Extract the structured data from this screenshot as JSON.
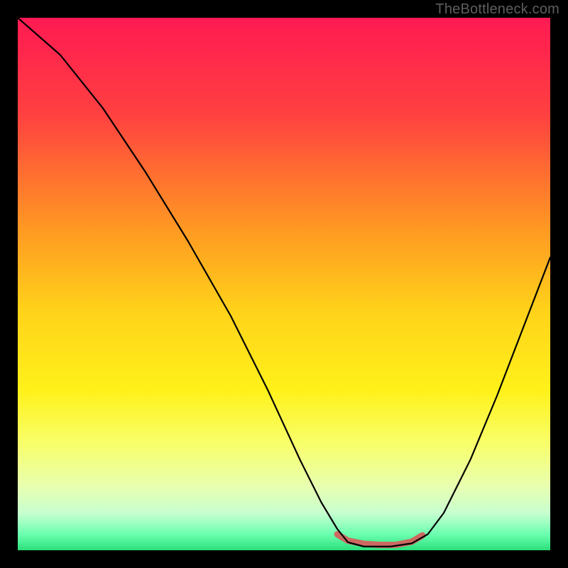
{
  "watermark": "TheBottleneck.com",
  "chart_data": {
    "type": "line",
    "title": "",
    "xlabel": "",
    "ylabel": "",
    "xlim": [
      0,
      100
    ],
    "ylim": [
      0,
      100
    ],
    "gradient_stops": [
      {
        "offset": 0,
        "color": "#ff1a53"
      },
      {
        "offset": 18,
        "color": "#ff4040"
      },
      {
        "offset": 40,
        "color": "#ff9a22"
      },
      {
        "offset": 55,
        "color": "#ffd21a"
      },
      {
        "offset": 70,
        "color": "#fff11a"
      },
      {
        "offset": 80,
        "color": "#f8ff6a"
      },
      {
        "offset": 88,
        "color": "#e8ffb0"
      },
      {
        "offset": 93,
        "color": "#c8ffd0"
      },
      {
        "offset": 97,
        "color": "#6bffb0"
      },
      {
        "offset": 100,
        "color": "#2bdf7a"
      }
    ],
    "series": [
      {
        "name": "bottleneck-curve",
        "stroke": "#000000",
        "stroke_width": 2.2,
        "points": [
          {
            "x": 0,
            "y": 100
          },
          {
            "x": 8,
            "y": 93
          },
          {
            "x": 16,
            "y": 83
          },
          {
            "x": 24,
            "y": 71
          },
          {
            "x": 32,
            "y": 58
          },
          {
            "x": 40,
            "y": 44
          },
          {
            "x": 47,
            "y": 30
          },
          {
            "x": 53,
            "y": 17
          },
          {
            "x": 57,
            "y": 9
          },
          {
            "x": 60,
            "y": 4
          },
          {
            "x": 62,
            "y": 1.5
          },
          {
            "x": 65,
            "y": 0.7
          },
          {
            "x": 70,
            "y": 0.7
          },
          {
            "x": 74,
            "y": 1.3
          },
          {
            "x": 77,
            "y": 3
          },
          {
            "x": 80,
            "y": 7
          },
          {
            "x": 85,
            "y": 17
          },
          {
            "x": 90,
            "y": 29
          },
          {
            "x": 95,
            "y": 42
          },
          {
            "x": 100,
            "y": 55
          }
        ]
      },
      {
        "name": "highlight-band",
        "stroke": "#cc6a62",
        "stroke_width": 9,
        "points": [
          {
            "x": 60,
            "y": 3
          },
          {
            "x": 62,
            "y": 1.8
          },
          {
            "x": 65,
            "y": 1.2
          },
          {
            "x": 68,
            "y": 1.0
          },
          {
            "x": 71,
            "y": 1.0
          },
          {
            "x": 74,
            "y": 1.6
          },
          {
            "x": 76,
            "y": 2.8
          }
        ]
      }
    ]
  }
}
